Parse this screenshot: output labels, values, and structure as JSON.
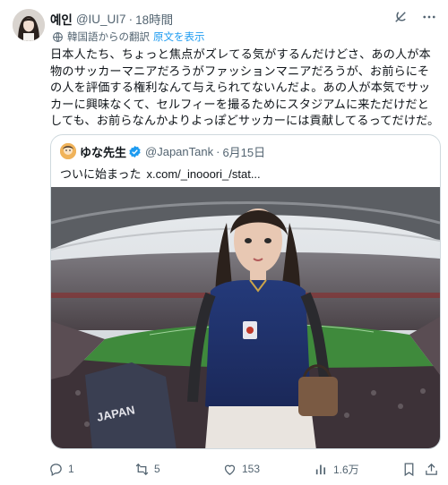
{
  "tweet": {
    "author": {
      "display_name": "예인",
      "handle": "@IU_UI7",
      "separator": "·",
      "time": "18時間"
    },
    "translated_label": "韓国語からの翻訳",
    "show_original_label": "原文を表示",
    "text": "日本人たち、ちょっと焦点がズレてる気がするんだけどさ、あの人が本物のサッカーマニアだろうがファッションマニアだろうが、お前らにその人を評価する権利なんて与えられてないんだよ。あの人が本気でサッカーに興味なくて、セルフィーを撮るためにスタジアムに来ただけだとしても、お前らなんかよりよっぽどサッカーには貢献してるってだけだ。",
    "icons": {
      "grok": "grok-icon",
      "more": "more-icon",
      "translate": "globe-icon"
    }
  },
  "quote": {
    "author": {
      "display_name": "ゆな先生",
      "handle": "@JapanTank",
      "separator": "·",
      "date": "6月15日"
    },
    "text": "ついに始まった",
    "link": "x.com/_inooori_/stat..."
  },
  "actions": {
    "replies": "1",
    "retweets": "5",
    "likes": "153",
    "views": "1.6万"
  },
  "colors": {
    "accent": "#1d9bf0",
    "muted": "#536471",
    "border": "#cfd9de",
    "text": "#0f1419"
  }
}
